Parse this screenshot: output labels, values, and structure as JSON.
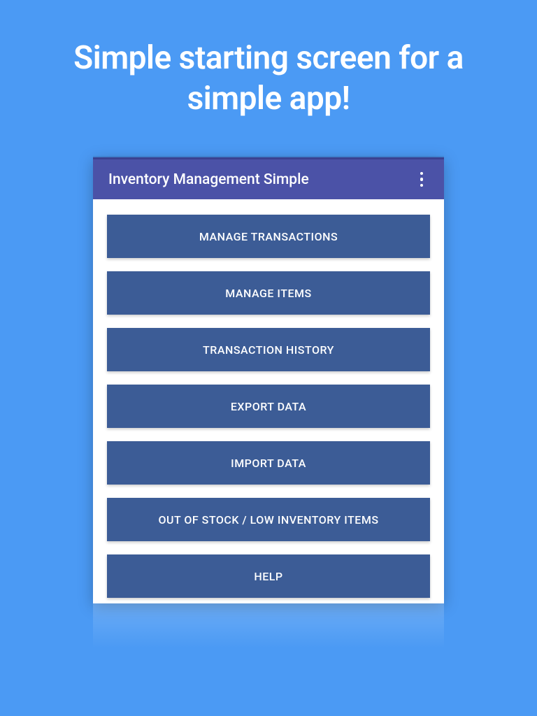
{
  "promo": {
    "heading": "Simple starting screen for a simple app!"
  },
  "appbar": {
    "title": "Inventory Management Simple"
  },
  "menu": {
    "items": [
      {
        "label": "MANAGE TRANSACTIONS"
      },
      {
        "label": "MANAGE ITEMS"
      },
      {
        "label": "TRANSACTION HISTORY"
      },
      {
        "label": "EXPORT DATA"
      },
      {
        "label": "IMPORT DATA"
      },
      {
        "label": "OUT OF STOCK / LOW INVENTORY ITEMS"
      },
      {
        "label": "HELP"
      }
    ]
  }
}
